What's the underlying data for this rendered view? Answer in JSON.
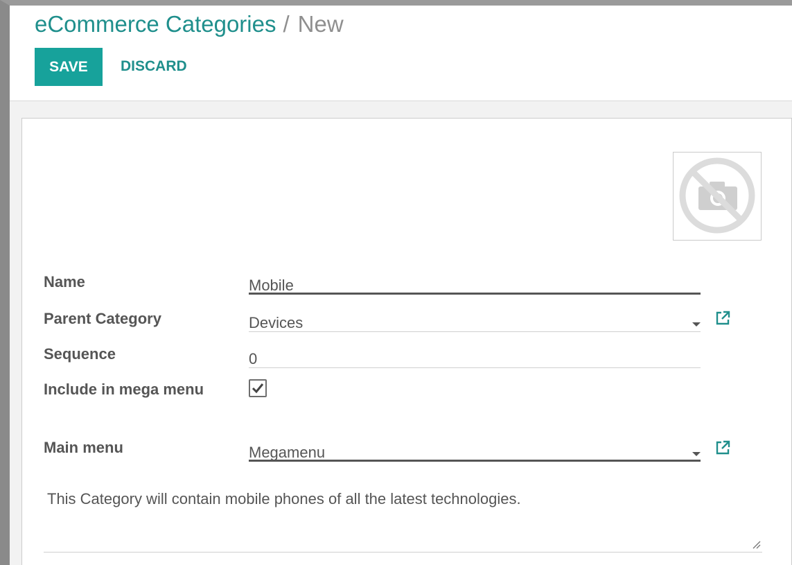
{
  "breadcrumb": {
    "parent": "eCommerce Categories",
    "separator": "/",
    "current": "New"
  },
  "toolbar": {
    "save_label": "SAVE",
    "discard_label": "DISCARD"
  },
  "form": {
    "image_icon": "camera-disabled-icon",
    "fields": {
      "name": {
        "label": "Name",
        "value": "Mobile"
      },
      "parent_category": {
        "label": "Parent Category",
        "value": "Devices"
      },
      "sequence": {
        "label": "Sequence",
        "value": "0"
      },
      "include_mega_menu": {
        "label": "Include in mega menu",
        "checked": true
      },
      "main_menu": {
        "label": "Main menu",
        "value": "Megamenu"
      }
    },
    "description": "This Category will contain mobile phones of all the latest technologies."
  },
  "colors": {
    "accent": "#17a29b",
    "link": "#1f8f8c"
  }
}
